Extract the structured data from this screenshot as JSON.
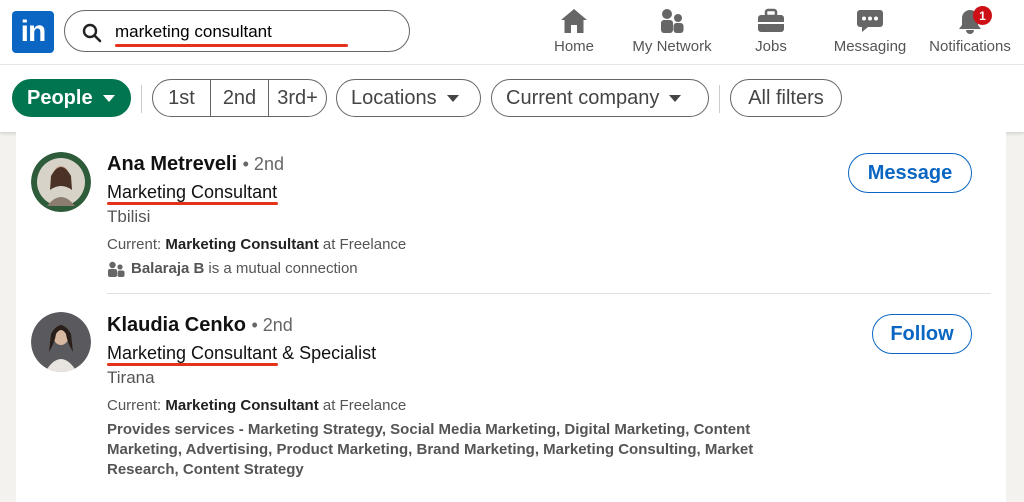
{
  "header": {
    "logo_text": "in",
    "search": {
      "value": "marketing consultant"
    },
    "nav": [
      {
        "label": "Home",
        "icon": "home-icon"
      },
      {
        "label": "My Network",
        "icon": "network-icon"
      },
      {
        "label": "Jobs",
        "icon": "briefcase-icon"
      },
      {
        "label": "Messaging",
        "icon": "messaging-icon"
      },
      {
        "label": "Notifications",
        "icon": "bell-icon",
        "badge": "1"
      }
    ]
  },
  "filters": {
    "people": "People",
    "degrees": [
      "1st",
      "2nd",
      "3rd+"
    ],
    "locations": "Locations",
    "current_company": "Current company",
    "all_filters": "All filters"
  },
  "results": [
    {
      "name": "Ana Metreveli",
      "degree": "• 2nd",
      "headline": "Marketing Consultant",
      "location": "Tbilisi",
      "current_prefix": "Current: ",
      "current_title": "Marketing Consultant",
      "current_suffix": " at Freelance",
      "mutual_name": "Balaraja B",
      "mutual_suffix": "is a mutual connection",
      "action": "Message"
    },
    {
      "name": "Klaudia Cenko",
      "degree": "• 2nd",
      "headline": "Marketing Consultant & Specialist",
      "location": "Tirana",
      "current_prefix": "Current: ",
      "current_title": "Marketing Consultant",
      "current_suffix": " at Freelance",
      "services_prefix": "Provides services - ",
      "services": "Marketing Strategy, Social Media Marketing, Digital Marketing, Content Marketing, Advertising, Product Marketing, Brand Marketing, Marketing Consulting, Market Research, Content Strategy",
      "action": "Follow"
    }
  ],
  "colors": {
    "brand_blue": "#0a66c2",
    "people_green": "#01754f",
    "highlight_red": "#e4321b",
    "badge_red": "#cc1016"
  }
}
